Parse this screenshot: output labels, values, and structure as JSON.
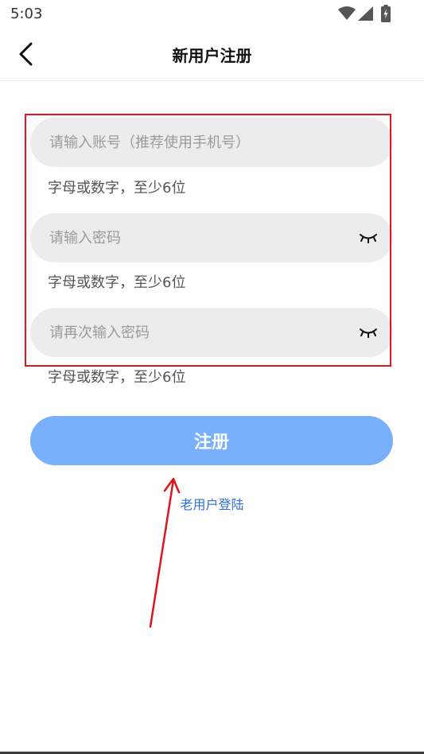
{
  "status_bar": {
    "time": "5:03",
    "icons": [
      "wifi-icon",
      "signal-icon",
      "battery-icon"
    ]
  },
  "header": {
    "title": "新用户注册",
    "back_icon": "chevron-left-icon"
  },
  "form": {
    "account": {
      "placeholder": "请输入账号（推荐使用手机号）",
      "value": "",
      "hint": "字母或数字，至少6位"
    },
    "password": {
      "placeholder": "请输入密码",
      "value": "",
      "hint": "字母或数字，至少6位",
      "toggle_icon": "eye-closed-icon"
    },
    "confirm_password": {
      "placeholder": "请再次输入密码",
      "value": "",
      "hint": "字母或数字，至少6位",
      "toggle_icon": "eye-closed-icon"
    }
  },
  "register_button": {
    "label": "注册"
  },
  "login_link": {
    "label": "老用户登陆"
  },
  "colors": {
    "accent": "#78b0fb",
    "link": "#2f6fd6",
    "field_bg": "#ececec",
    "annotation": "#e0151c"
  }
}
